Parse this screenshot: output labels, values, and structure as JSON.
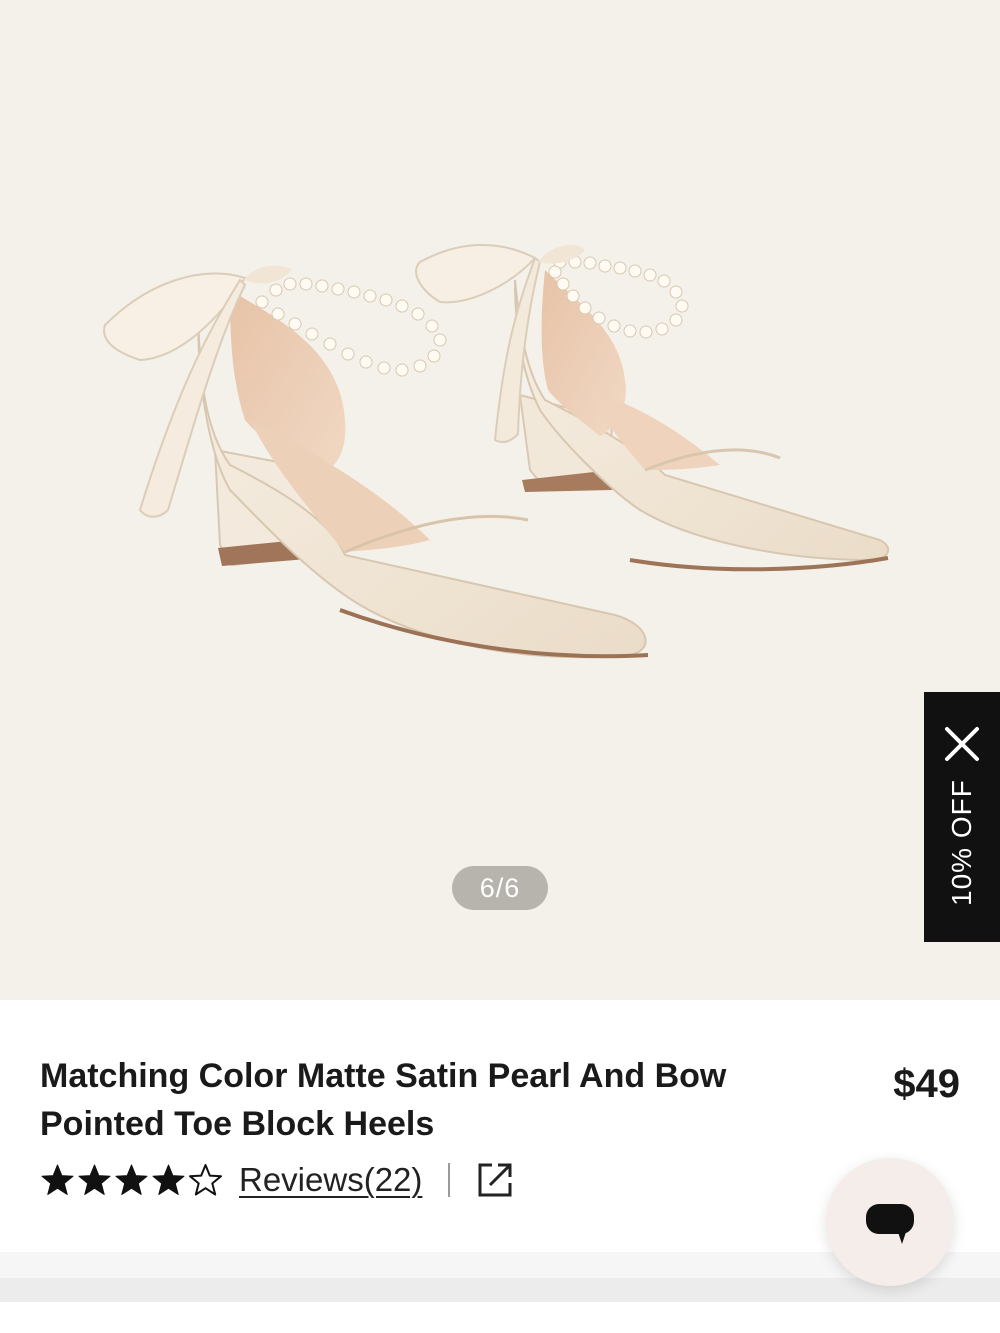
{
  "gallery": {
    "image_alt": "Matching Color Matte Satin Pearl And Bow Pointed Toe Block Heels",
    "page_indicator": "6/6",
    "current_index": 6,
    "total_images": 6
  },
  "promo": {
    "label": "10% OFF",
    "close_icon": "close-icon"
  },
  "product": {
    "title": "Matching Color Matte Satin Pearl And Bow Pointed Toe Block Heels",
    "price": "$49",
    "rating": 4,
    "rating_max": 5,
    "reviews_label": "Reviews(22)",
    "share_icon": "external-link-icon"
  },
  "chat": {
    "icon": "chat-bubble-icon"
  },
  "colors": {
    "gallery_bg": "#f4f1ea",
    "promo_bg": "#111111",
    "chat_bg": "#f4ede9",
    "text": "#1a1a1a"
  }
}
